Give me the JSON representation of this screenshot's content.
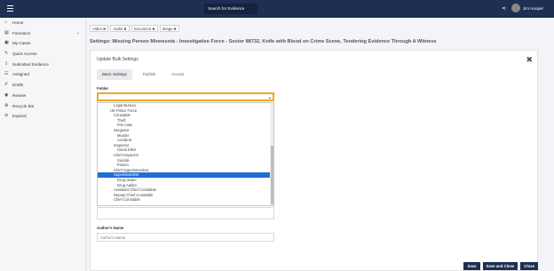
{
  "topbar": {
    "search_label": "Search for Evidence",
    "user_name": "Jim Hooper"
  },
  "sidebar": {
    "items": [
      {
        "label": "Home",
        "icon": "⌂"
      },
      {
        "label": "Forensics",
        "icon": "▤",
        "chevron": "⌄"
      },
      {
        "label": "My Cases",
        "icon": "▣"
      },
      {
        "label": "Quick Access",
        "icon": "✎"
      },
      {
        "label": "Submitted Evidence",
        "icon": "⇪"
      },
      {
        "label": "Assigned",
        "icon": "☷"
      },
      {
        "label": "Drafts",
        "icon": "✐"
      },
      {
        "label": "Review",
        "icon": "◉"
      },
      {
        "label": "Recycle Bin",
        "icon": "♻"
      },
      {
        "label": "Expired",
        "icon": "⊘"
      }
    ]
  },
  "tags": [
    "Video",
    "Audio",
    "Document",
    "Image"
  ],
  "settings_title": "Settings: Missing Person Minnesota - Investigative Force - Sector 88732, Knife with Blood on Crime Scene, Tendering Evidence Through A Witness",
  "modal": {
    "title": "Update Bulk Settings",
    "tabs": [
      "Basic Settings",
      "Publish",
      "Access"
    ],
    "folder_label": "Folder",
    "author_label": "Author's Name",
    "author_placeholder": "Author's Name"
  },
  "dropdown_options": [
    {
      "label": "Legal Bureau",
      "indent": 1
    },
    {
      "label": "UK Police Force",
      "indent": 0
    },
    {
      "label": "Constable",
      "indent": 1
    },
    {
      "label": "Theft",
      "indent": 2
    },
    {
      "label": "Fire case",
      "indent": 2
    },
    {
      "label": "Sergeant",
      "indent": 1
    },
    {
      "label": "Murder",
      "indent": 2
    },
    {
      "label": "Accident",
      "indent": 2
    },
    {
      "label": "Inspector",
      "indent": 1
    },
    {
      "label": "Serial Killer",
      "indent": 2
    },
    {
      "label": "Chief Inspector",
      "indent": 1
    },
    {
      "label": "Suicide",
      "indent": 2
    },
    {
      "label": "Poison",
      "indent": 2
    },
    {
      "label": "Chief Superintendent",
      "indent": 1
    },
    {
      "label": "Superintendent",
      "indent": 1,
      "selected": true
    },
    {
      "label": "Drug dealer",
      "indent": 2
    },
    {
      "label": "Drug Addict",
      "indent": 2
    },
    {
      "label": "Assistant Chief Constable",
      "indent": 1
    },
    {
      "label": "Deputy Chief Constable",
      "indent": 1
    },
    {
      "label": "Chief Constable",
      "indent": 1
    }
  ],
  "buttons": [
    "Save",
    "Save and Close",
    "Close"
  ]
}
